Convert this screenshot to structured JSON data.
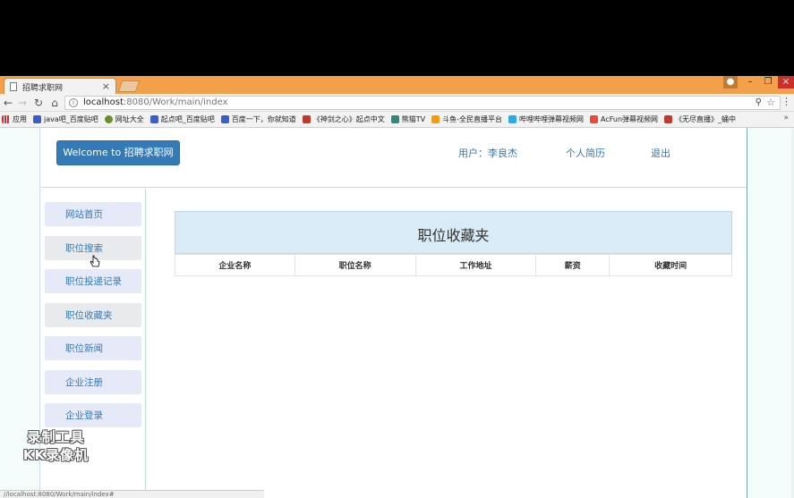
{
  "browser": {
    "tab_title": "招聘求职网",
    "tab_close": "×",
    "url_host": "localhost",
    "url_path": ":8080/Work/main/index",
    "window_controls": [
      "–",
      "❐",
      "×"
    ],
    "bookmarks": [
      "应用",
      "java吧_百度贴吧",
      "网址大全",
      "起点吧_百度贴吧",
      "百度一下，你就知道",
      "《神剑之心》起点中文",
      "熊猫TV",
      "斗鱼-全民直播平台",
      "哔哩哔哩弹幕视频网",
      "AcFun弹幕视频网",
      "《无尽直播》_蛹中"
    ],
    "bookmarks_more": "»",
    "status_text": "//localhost:8080/Work/main/index#"
  },
  "header": {
    "welcome": "Welcome to 招聘求职网",
    "user": "用户：李良杰",
    "resume": "个人简历",
    "logout": "退出"
  },
  "sidebar": {
    "items": [
      "网站首页",
      "职位搜索",
      "职位投递记录",
      "职位收藏夹",
      "职位新闻",
      "企业注册",
      "企业登录"
    ]
  },
  "main": {
    "title": "职位收藏夹",
    "columns": [
      "企业名称",
      "职位名称",
      "工作地址",
      "薪资",
      "收藏时间"
    ]
  },
  "watermark": {
    "line1": "录制工具",
    "line2": "KK录像机"
  }
}
